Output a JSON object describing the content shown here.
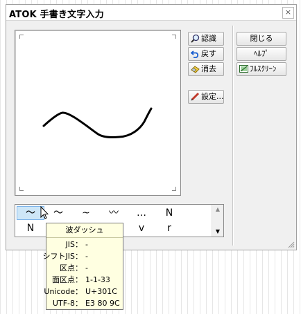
{
  "window": {
    "title": "ATOK 手書き文字入力",
    "close_glyph": "×"
  },
  "tools": {
    "recognize": "認識",
    "undo": "戻す",
    "erase": "消去",
    "settings": "設定..."
  },
  "side": {
    "close": "閉じる",
    "help": "ﾍﾙﾌﾟ",
    "fullscreen": "ﾌﾙｽｸﾘｰﾝ"
  },
  "candidates": {
    "row1": [
      "〜",
      "～",
      "~",
      "〰",
      "…",
      "N"
    ],
    "row2": [
      "N",
      "",
      "",
      "",
      "v",
      "r"
    ]
  },
  "tooltip": {
    "title": "波ダッシュ",
    "rows": [
      {
        "key": "JIS：",
        "value": "-"
      },
      {
        "key": "シフトJIS：",
        "value": "-"
      },
      {
        "key": "区点：",
        "value": "-"
      },
      {
        "key": "面区点：",
        "value": "1-1-33"
      },
      {
        "key": "Unicode：",
        "value": "U+301C"
      },
      {
        "key": "UTF-8：",
        "value": "E3 80 9C"
      }
    ]
  },
  "icons": {
    "recognize": "magnifier-icon",
    "undo": "undo-arrow-icon",
    "erase": "eraser-icon",
    "settings": "pencil-icon",
    "fullscreen": "fullscreen-icon"
  },
  "colors": {
    "window_bg": "#f0f0f0",
    "selection": "#cde6f7",
    "tooltip_bg": "#ffffe1"
  }
}
